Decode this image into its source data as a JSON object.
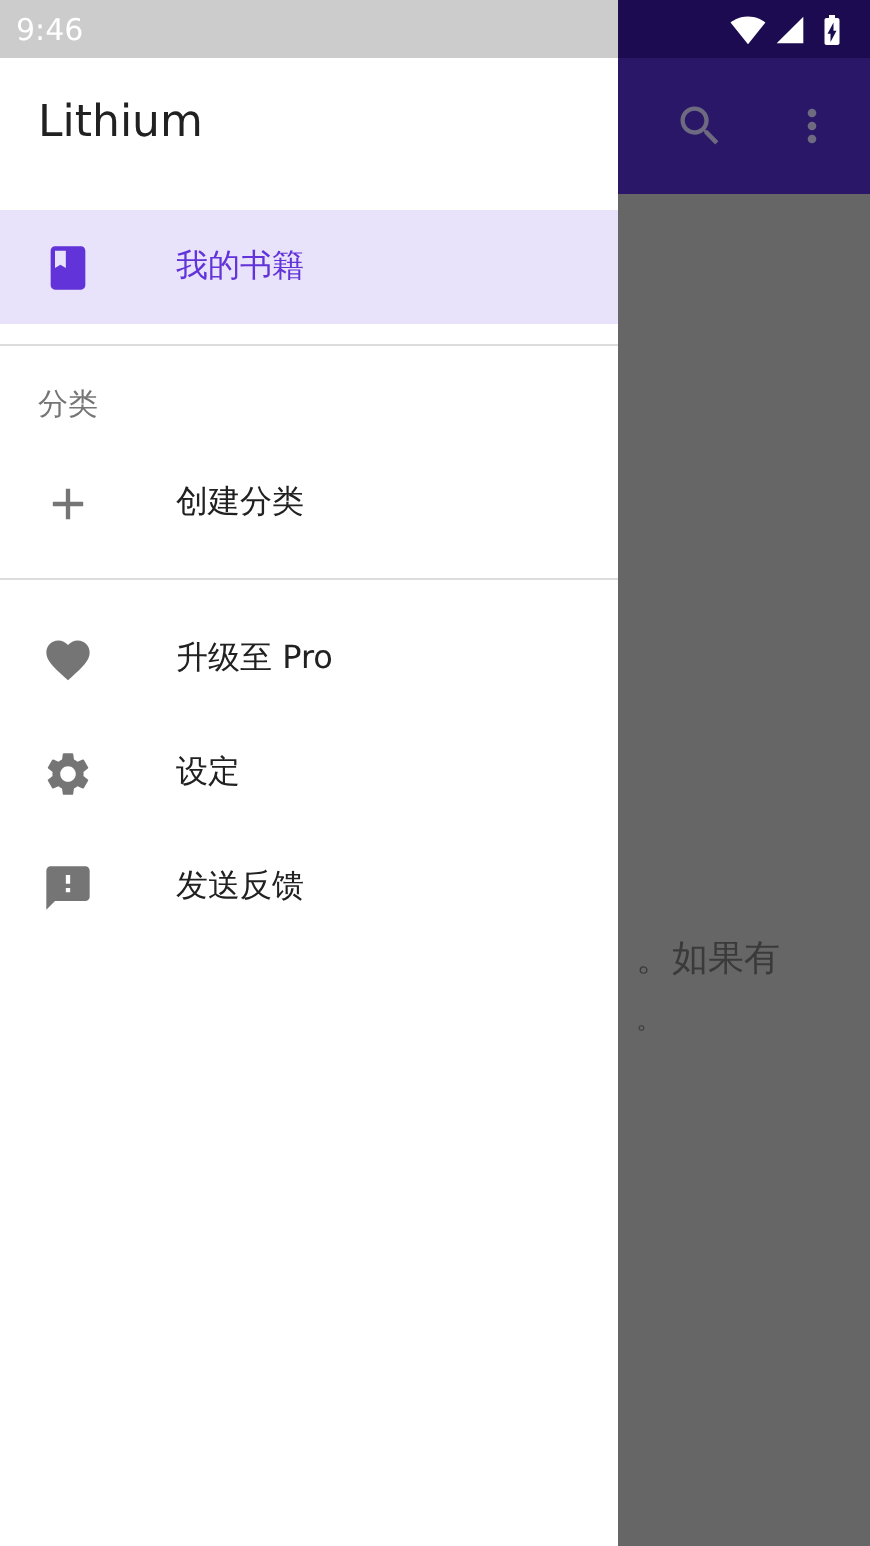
{
  "status_bar": {
    "time": "9:46"
  },
  "background_text": [
    "。如果有",
    "。"
  ],
  "drawer": {
    "title": "Lithium",
    "items": [
      {
        "label": "我的书籍",
        "selected": true
      }
    ],
    "section": {
      "header": "分类",
      "items": [
        {
          "label": "创建分类",
          "selected": false
        }
      ]
    },
    "footer_items": [
      {
        "label": "升级至 Pro",
        "selected": false
      },
      {
        "label": "设定",
        "selected": false
      },
      {
        "label": "发送反馈",
        "selected": false
      }
    ]
  }
}
